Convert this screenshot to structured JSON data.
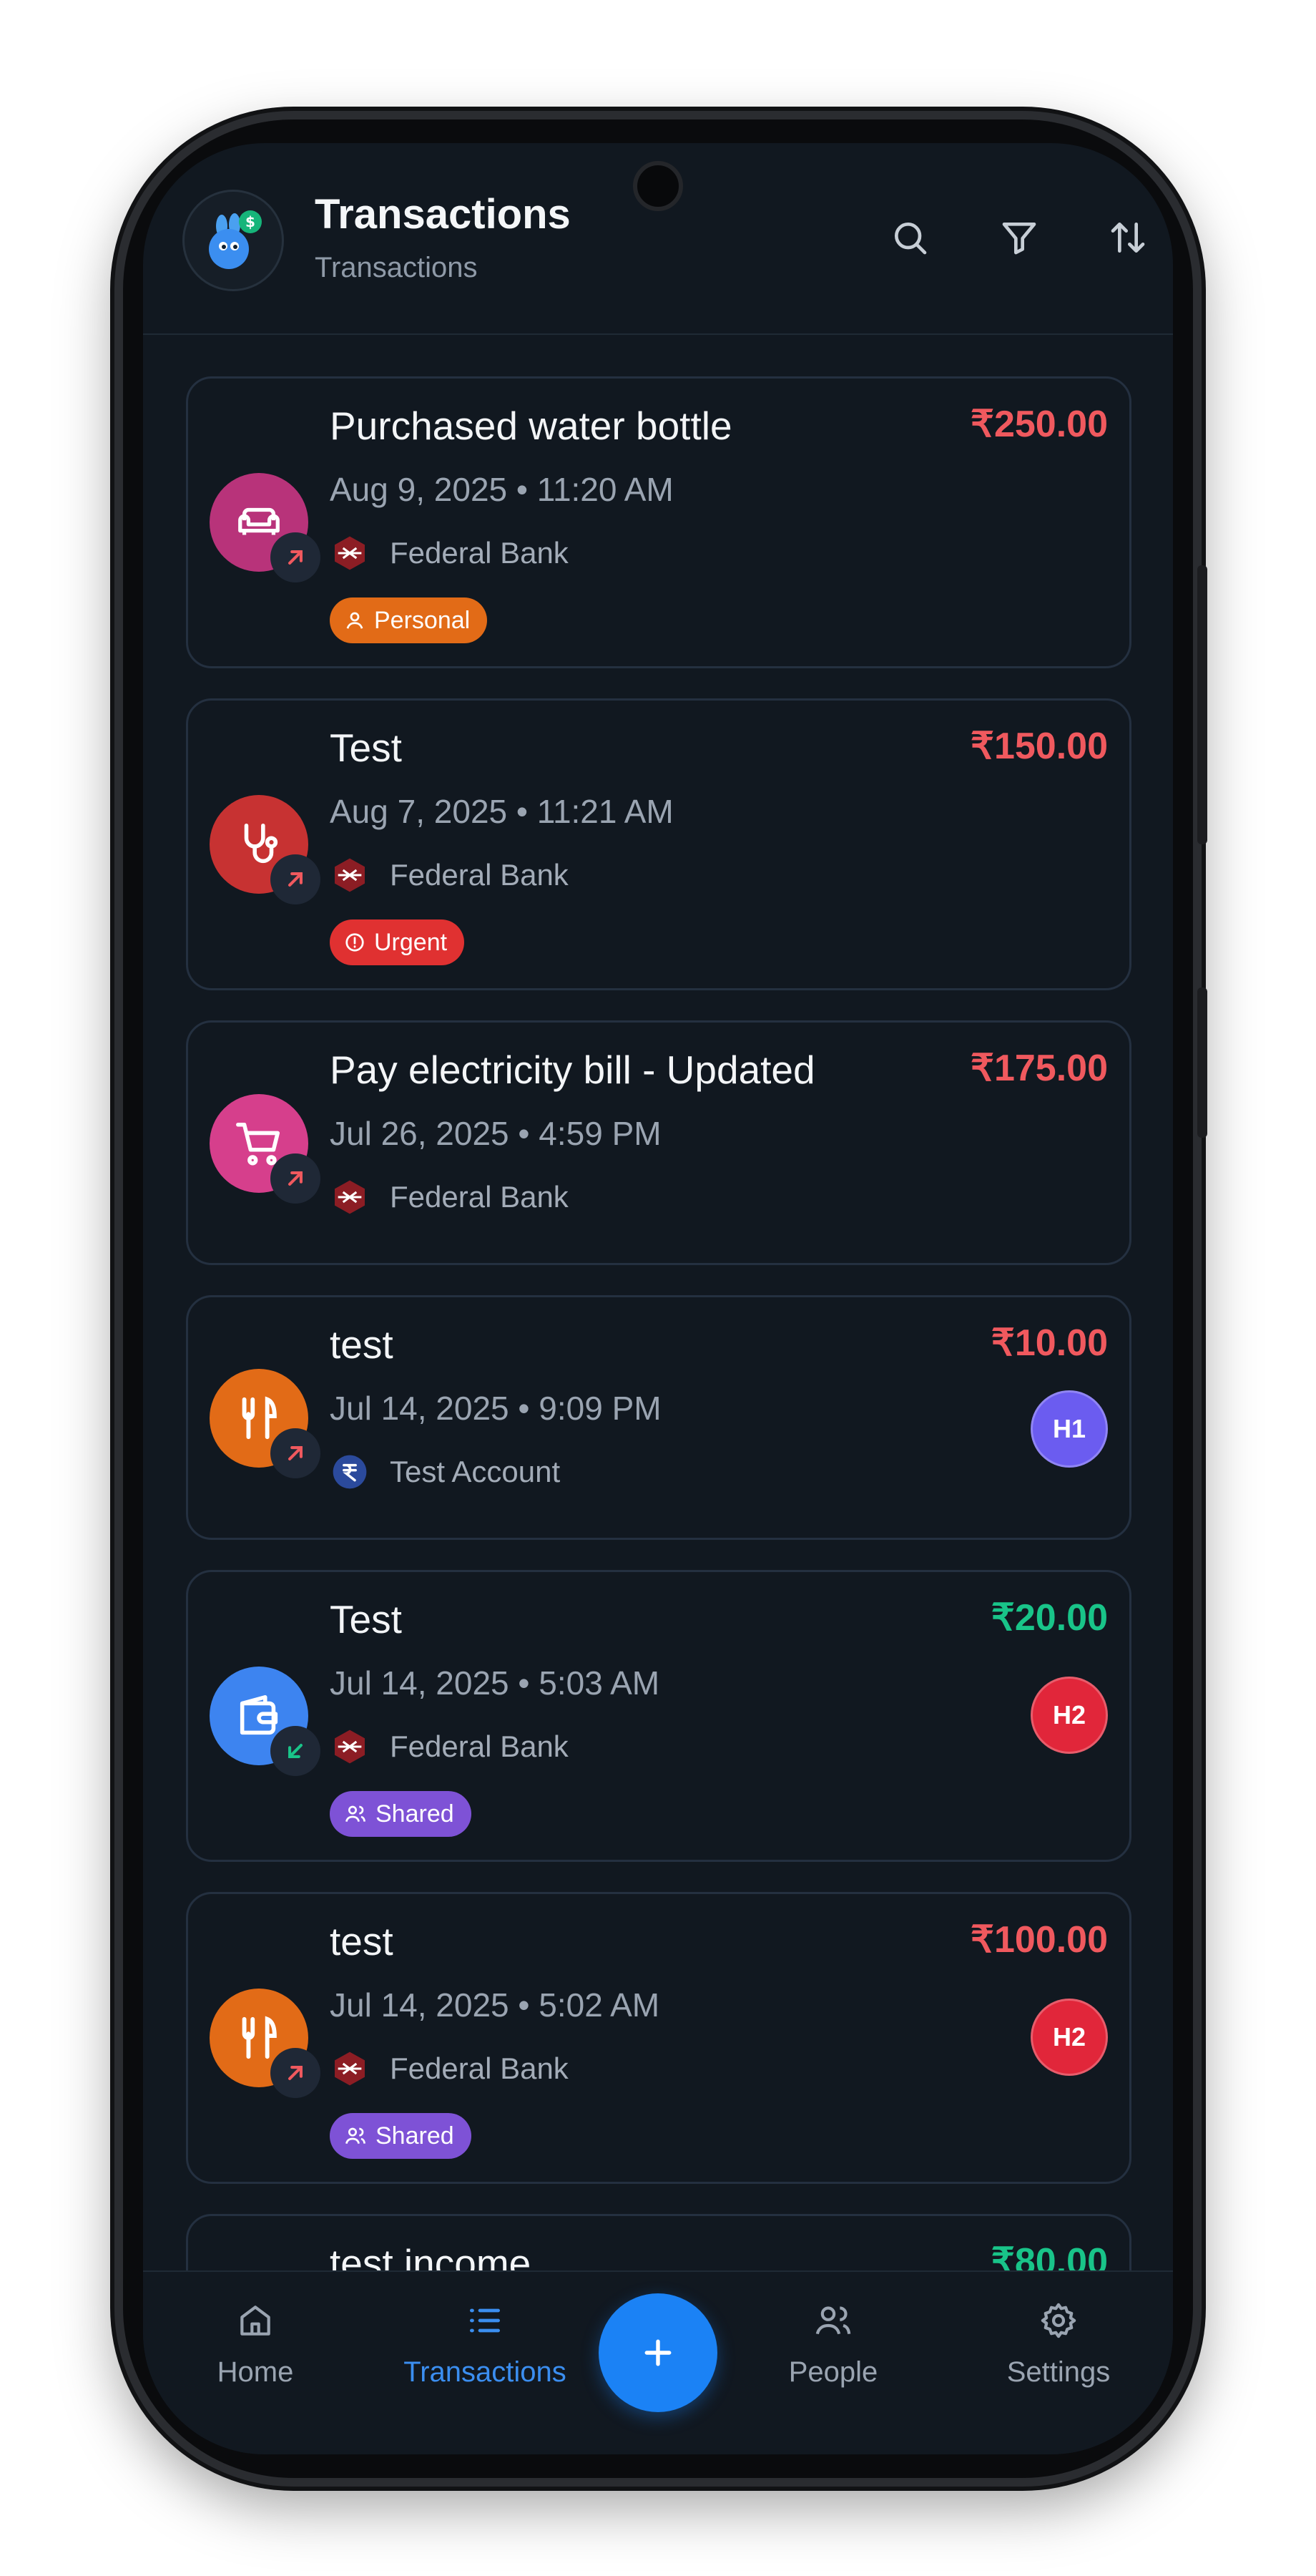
{
  "header": {
    "title": "Transactions",
    "subtitle": "Transactions",
    "icons": [
      "search-icon",
      "filter-icon",
      "sort-icon"
    ]
  },
  "colors": {
    "background": "#111820",
    "expense": "#f0595e",
    "income": "#19c489",
    "accent": "#1b82f5"
  },
  "transactions": [
    {
      "title": "Purchased water bottle",
      "amount": "₹250.00",
      "type": "expense",
      "datetime": "Aug 9, 2025 • 11:20 AM",
      "account": "Federal Bank",
      "category_icon": "sofa-icon",
      "category_color": "#b8337a",
      "tag": "Personal",
      "tag_color": "#e26b17"
    },
    {
      "title": "Test",
      "amount": "₹150.00",
      "type": "expense",
      "datetime": "Aug 7, 2025 • 11:21 AM",
      "account": "Federal Bank",
      "category_icon": "stethoscope-icon",
      "category_color": "#c73232",
      "tag": "Urgent",
      "tag_color": "#e03131"
    },
    {
      "title": "Pay electricity bill - Updated",
      "amount": "₹175.00",
      "type": "expense",
      "datetime": "Jul 26, 2025 • 4:59 PM",
      "account": "Federal Bank",
      "category_icon": "shopping-cart-icon",
      "category_color": "#d63f8c"
    },
    {
      "title": "test",
      "amount": "₹10.00",
      "type": "expense",
      "datetime": "Jul 14, 2025 • 9:09 PM",
      "account": "Test Account",
      "category_icon": "fork-knife-icon",
      "category_color": "#e26b17",
      "person": "H1",
      "person_color": "#6b5cf0"
    },
    {
      "title": "Test",
      "amount": "₹20.00",
      "type": "income",
      "datetime": "Jul 14, 2025 • 5:03 AM",
      "account": "Federal Bank",
      "category_icon": "wallet-icon",
      "category_color": "#3d84f0",
      "tag": "Shared",
      "tag_color": "#7e52d6",
      "person": "H2",
      "person_color": "#e1263a"
    },
    {
      "title": "test",
      "amount": "₹100.00",
      "type": "expense",
      "datetime": "Jul 14, 2025 • 5:02 AM",
      "account": "Federal Bank",
      "category_icon": "fork-knife-icon",
      "category_color": "#e26b17",
      "tag": "Shared",
      "tag_color": "#7e52d6",
      "person": "H2",
      "person_color": "#e1263a"
    },
    {
      "title": "test income",
      "amount": "₹80.00",
      "type": "income"
    }
  ],
  "nav": {
    "items": [
      {
        "label": "Home",
        "icon": "home-icon"
      },
      {
        "label": "Transactions",
        "icon": "list-icon",
        "active": true
      },
      {
        "label": "People",
        "icon": "people-icon"
      },
      {
        "label": "Settings",
        "icon": "gear-icon"
      }
    ],
    "fab_icon": "plus-icon"
  }
}
